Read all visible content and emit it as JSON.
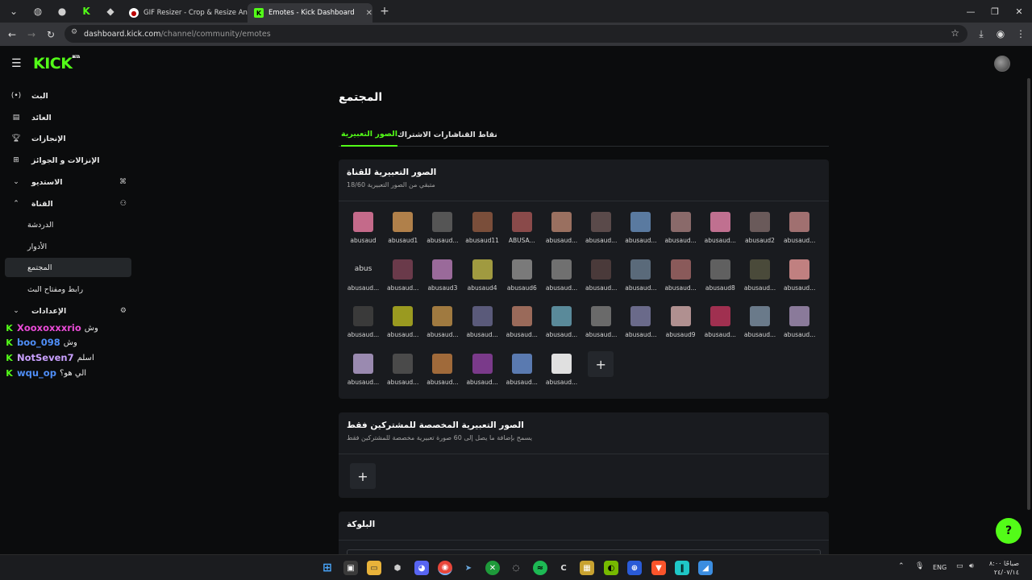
{
  "browser": {
    "tabs": [
      {
        "title": "GIF Resizer - Crop & Resize Ani",
        "active": false
      },
      {
        "title": "Emotes - Kick Dashboard",
        "active": true
      }
    ],
    "url_host": "dashboard.kick.com",
    "url_path": "/channel/community/emotes"
  },
  "app": {
    "logo": "KICK",
    "logo_badge": "BETA",
    "accent_color": "#53fc18"
  },
  "sidebar": {
    "items": [
      {
        "label": "البث",
        "icon": "broadcast-icon"
      },
      {
        "label": "العائد",
        "icon": "chart-icon"
      },
      {
        "label": "الإنجازات",
        "icon": "trophy-icon"
      },
      {
        "label": "الإنزالات و الجوائز",
        "icon": "gift-icon"
      },
      {
        "label": "الاستديو",
        "icon": "studio-icon"
      },
      {
        "label": "القناة",
        "icon": "channel-icon"
      },
      {
        "label": "الدردشة"
      },
      {
        "label": "الأدوار"
      },
      {
        "label": "المجتمع"
      },
      {
        "label": "رابط ومفتاح البث"
      },
      {
        "label": "الإعدادات",
        "icon": "gear-icon"
      }
    ]
  },
  "chat": [
    {
      "user": "Xooxoxxxrio",
      "msg": "وش",
      "color": "#e94bd6"
    },
    {
      "user": "boo_098",
      "msg": "وش",
      "color": "#4f8ef7"
    },
    {
      "user": "NotSeven7",
      "msg": "اسلم",
      "color": "#c9a0ff"
    },
    {
      "user": "wqu_op",
      "msg": "الي هو؟",
      "color": "#4f8ef7"
    }
  ],
  "main": {
    "title": "المجتمع",
    "tabs": [
      "نقاط القناة",
      "شارات الاشتراك",
      "الصور التعبيرية"
    ],
    "channel_emotes": {
      "title": "الصور التعبيرية للقناة",
      "subtitle": "متبقي من الصور التعبيرية 18/60",
      "emotes": [
        "abusaud",
        "abusaud1",
        "abusaud...",
        "abusaud11",
        "ABUSA...",
        "abusaud...",
        "abusaud...",
        "abusaud...",
        "abusaud...",
        "abusaud...",
        "abusaud2",
        "abusaud...",
        "abusaud...",
        "abusaud...",
        "abusaud3",
        "abusaud4",
        "abusaud6",
        "abusaud...",
        "abusaud...",
        "abusaud...",
        "abusaud...",
        "abusaud8",
        "abusaud...",
        "abusaud...",
        "abusaud...",
        "abusaud...",
        "abusaud...",
        "abusaud...",
        "abusaud...",
        "abusaud...",
        "abusaud...",
        "abusaud...",
        "abusaud9",
        "abusaud...",
        "abusaud...",
        "abusaud...",
        "abusaud...",
        "abusaud...",
        "abusaud...",
        "abusaud...",
        "abusaud...",
        "abusaud..."
      ],
      "broken_alt": "abus"
    },
    "sub_emotes": {
      "title": "الصور التعبيرية المخصصة للمشتركين فقط",
      "subtitle": "يسمح بإضافة ما يصل إلى 60 صورة تعبيرية مخصصة للمشتركين فقط"
    },
    "blocked": {
      "title": "البلوكة"
    }
  },
  "taskbar": {
    "lang": "ENG",
    "time": "صباحًا ٨:٠٠",
    "date": "٢٤/٠٧/١٤"
  }
}
